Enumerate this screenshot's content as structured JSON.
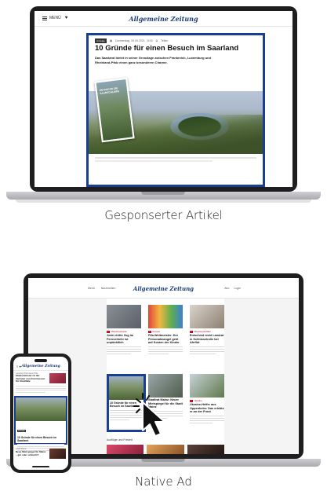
{
  "sections": {
    "sponsored_label": "Gesponserter Artikel",
    "native_label": "Native Ad"
  },
  "laptop1": {
    "menu_label": "MENÜ",
    "logo": "Allgemeine Zeitung",
    "article": {
      "badge": "Anzeige",
      "date": "Donnerstag, 09.09.2021 · 8:00",
      "share": "Teilen",
      "title": "10 Gründe für einen Besuch im Saarland",
      "lead": "Das Saarland bietet in seiner Grenzlage zwischen Frankreich, Luxemburg und Rheinland-Pfalz einen ganz besonderen Charme.",
      "card_text": "Entdecke die Saarschleife"
    }
  },
  "laptop2": {
    "nav_left": [
      "Menü",
      "Nachrichten"
    ],
    "logo": "Allgemeine Zeitung",
    "nav_right": [
      "Abo",
      "Login"
    ],
    "cards": [
      {
        "kicker": "Mittelrheinbahn",
        "title": "Jeder dritte Zug im Fernverkehr ist unpünktlich"
      },
      {
        "kicker": "Protest",
        "title": "Fifa-Weltmeister: Der Personalmangel geht auf Kosten der Kinder"
      },
      {
        "kicker": "Rheinland-Pfalz",
        "title": "Entschied nicht Landrat in Schlüsselrolle bei Ahrflut"
      },
      {
        "kicker": "",
        "title": "10 Gründe für einen Besuch im Saarland"
      },
      {
        "kicker": "",
        "title": "Stadtrat Mainz: Neuer Mietspiegel für die Stadt Mainz"
      },
      {
        "kicker": "Ukraine",
        "title": "Ukraine-Helfer aus Oppenheim: Das erlebte er an der Front"
      }
    ],
    "section_title": "Ausflüge und Freizeit"
  },
  "phone": {
    "logo": "Allgemeine Zeitung",
    "top_kicker": "Landtag Rheinland-Pfalz",
    "top_title": "Staatsminister ist der Vertreter von Kommission für Streitfälle",
    "native_badge": "Anzeige",
    "native_title": "10 Gründe für einen Besuch im Saarland",
    "bottom_kicker": "Stadt Mainz",
    "bottom_title": "Neue Mietspiegel für Mainz – gut oder schlecht?"
  }
}
